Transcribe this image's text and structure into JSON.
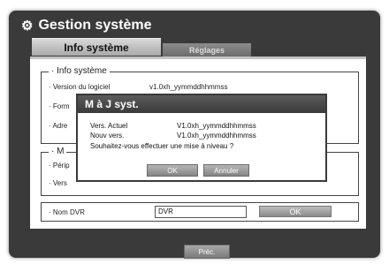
{
  "window": {
    "title": "Gestion système",
    "icon": "gear-icon"
  },
  "tabs": [
    {
      "label": "Info système",
      "active": true
    },
    {
      "label": "Réglages",
      "active": false
    }
  ],
  "system_info": {
    "legend": "· Info système",
    "software_label": "· Version du logiciel",
    "software_value": "v1.0xh_yymmddhhmmss",
    "format_label": "· Form",
    "address_label": "· Adre"
  },
  "second_group": {
    "legend": "· M",
    "peripheral_label": "· Périp",
    "version_label": "· Vers"
  },
  "dvr": {
    "label": "· Nom DVR",
    "value": "DVR",
    "ok_label": "OK"
  },
  "footer": {
    "prev_label": "Préc."
  },
  "dialog": {
    "title": "M à J syst.",
    "current_label": "Vers. Actuel",
    "current_value": "V1.0xh_yymmddhhmmss",
    "new_label": "Nouv vers.",
    "new_value": "V1.0xh_yymmddhhmmss",
    "question": "Souhaitez-vous effectuer une mise à niveau ?",
    "ok_label": "OK",
    "cancel_label": "Annuler"
  }
}
